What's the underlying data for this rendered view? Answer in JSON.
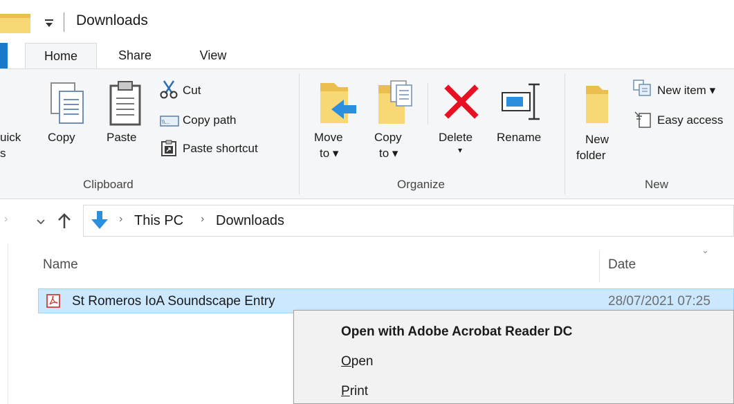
{
  "window": {
    "title": "Downloads"
  },
  "tabs": [
    {
      "label": "Home"
    },
    {
      "label": "Share"
    },
    {
      "label": "View"
    }
  ],
  "ribbon": {
    "clipboard": {
      "group_label": "Clipboard",
      "pin_label_line1": "uick",
      "pin_label_line2": "s",
      "copy_label": "Copy",
      "paste_label": "Paste",
      "cut_label": "Cut",
      "copy_path_label": "Copy path",
      "paste_shortcut_label": "Paste shortcut"
    },
    "organize": {
      "group_label": "Organize",
      "move_to_line1": "Move",
      "move_to_line2": "to",
      "copy_to_line1": "Copy",
      "copy_to_line2": "to",
      "delete_label": "Delete",
      "rename_label": "Rename"
    },
    "new": {
      "group_label": "New",
      "new_folder_line1": "New",
      "new_folder_line2": "folder",
      "new_item_label": "New item",
      "easy_access_label": "Easy access"
    }
  },
  "address": {
    "crumbs": [
      "This PC",
      "Downloads"
    ]
  },
  "file_list": {
    "columns": {
      "name": "Name",
      "date": "Date"
    },
    "rows": [
      {
        "name": "St Romeros IoA Soundscape Entry",
        "date": "28/07/2021 07:25"
      }
    ]
  },
  "context_menu": {
    "items": [
      {
        "label": "Open with Adobe Acrobat Reader DC",
        "accel": "",
        "rest": ""
      },
      {
        "label": "",
        "accel": "O",
        "rest": "pen"
      },
      {
        "label": "",
        "accel": "P",
        "rest": "rint"
      }
    ]
  },
  "colors": {
    "accent": "#1979ca",
    "selection": "#cce8ff",
    "delete_red": "#e81123",
    "folder_yellow": "#f8d775"
  }
}
